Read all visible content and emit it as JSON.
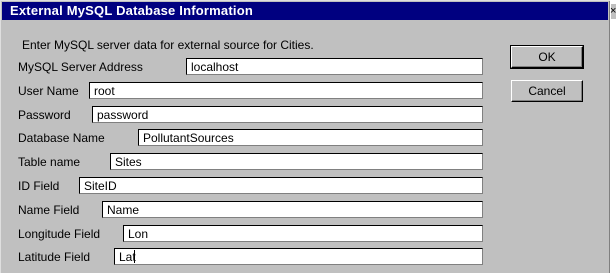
{
  "window": {
    "title": "External MySQL Database Information",
    "sys_button": "×"
  },
  "dialog": {
    "instructions": "Enter MySQL server data for external source for Cities."
  },
  "fields": [
    {
      "label": "MySQL Server Address",
      "value": "localhost"
    },
    {
      "label": "User Name",
      "value": "root"
    },
    {
      "label": "Password",
      "value": "password"
    },
    {
      "label": "Database Name",
      "value": "PollutantSources"
    },
    {
      "label": "Table name",
      "value": "Sites"
    },
    {
      "label": "ID Field",
      "value": "SiteID"
    },
    {
      "label": "Name Field",
      "value": "Name"
    },
    {
      "label": "Longitude Field",
      "value": "Lon"
    },
    {
      "label": "Latitude Field",
      "value": "Lat"
    }
  ],
  "buttons": {
    "ok_label": "OK",
    "cancel_label": "Cancel"
  }
}
